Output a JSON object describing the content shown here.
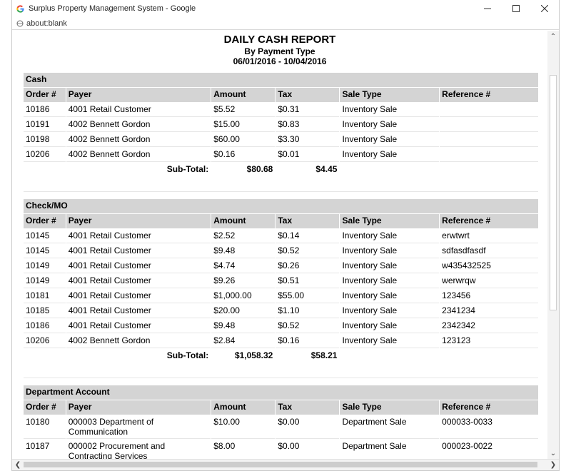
{
  "window": {
    "title": "Surplus Property Management System - Google",
    "address": "about:blank"
  },
  "report": {
    "title": "DAILY CASH REPORT",
    "subtitle": "By Payment Type",
    "date_range": "06/01/2016 - 10/04/2016"
  },
  "columns": [
    "Order #",
    "Payer",
    "Amount",
    "Tax",
    "Sale Type",
    "Reference #"
  ],
  "subtotal_label": "Sub-Total:",
  "sections": [
    {
      "title": "Cash",
      "rows": [
        [
          "10186",
          "4001 Retail Customer",
          "$5.52",
          "$0.31",
          "Inventory Sale",
          ""
        ],
        [
          "10191",
          "4002 Bennett Gordon",
          "$15.00",
          "$0.83",
          "Inventory Sale",
          ""
        ],
        [
          "10198",
          "4002 Bennett Gordon",
          "$60.00",
          "$3.30",
          "Inventory Sale",
          ""
        ],
        [
          "10206",
          "4002 Bennett Gordon",
          "$0.16",
          "$0.01",
          "Inventory Sale",
          ""
        ]
      ],
      "subtotal_amount": "$80.68",
      "subtotal_tax": "$4.45"
    },
    {
      "title": "Check/MO",
      "rows": [
        [
          "10145",
          "4001 Retail Customer",
          "$2.52",
          "$0.14",
          "Inventory Sale",
          "erwtwrt"
        ],
        [
          "10145",
          "4001 Retail Customer",
          "$9.48",
          "$0.52",
          "Inventory Sale",
          "sdfasdfasdf"
        ],
        [
          "10149",
          "4001 Retail Customer",
          "$4.74",
          "$0.26",
          "Inventory Sale",
          "w435432525"
        ],
        [
          "10149",
          "4001 Retail Customer",
          "$9.26",
          "$0.51",
          "Inventory Sale",
          "werwrqw"
        ],
        [
          "10181",
          "4001 Retail Customer",
          "$1,000.00",
          "$55.00",
          "Inventory Sale",
          "123456"
        ],
        [
          "10185",
          "4001 Retail Customer",
          "$20.00",
          "$1.10",
          "Inventory Sale",
          "2341234"
        ],
        [
          "10186",
          "4001 Retail Customer",
          "$9.48",
          "$0.52",
          "Inventory Sale",
          "2342342"
        ],
        [
          "10206",
          "4002 Bennett Gordon",
          "$2.84",
          "$0.16",
          "Inventory Sale",
          "123123"
        ]
      ],
      "subtotal_amount": "$1,058.32",
      "subtotal_tax": "$58.21"
    },
    {
      "title": "Department Account",
      "rows": [
        [
          "10180",
          "000003 Department of Communication",
          "$10.00",
          "$0.00",
          "Department Sale",
          "000033-0033"
        ],
        [
          "10187",
          "000002 Procurement and Contracting Services",
          "$8.00",
          "$0.00",
          "Department Sale",
          "000023-0022"
        ]
      ]
    }
  ],
  "icons": {
    "app": "google-g-icon",
    "page": "page-icon",
    "minimize": "minimize-icon",
    "maximize": "maximize-icon",
    "close": "close-icon"
  },
  "colors": {
    "header_bg": "#d4d4d4",
    "google_blue": "#4285f4",
    "google_red": "#ea4335",
    "google_yellow": "#fbbc05",
    "google_green": "#34a853"
  }
}
